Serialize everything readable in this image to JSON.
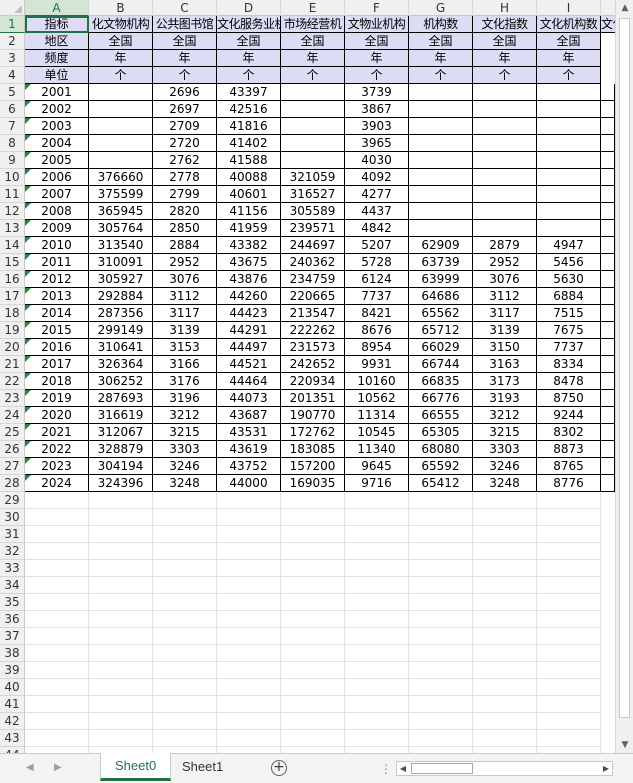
{
  "columns": [
    "A",
    "B",
    "C",
    "D",
    "E",
    "F",
    "G",
    "H",
    "I"
  ],
  "row_numbers": [
    "1",
    "2",
    "3",
    "4",
    "5",
    "6",
    "7",
    "8",
    "9",
    "10",
    "11",
    "12",
    "13",
    "14",
    "15",
    "16",
    "17",
    "18",
    "19",
    "20",
    "21",
    "22",
    "23",
    "24",
    "25",
    "26",
    "27",
    "28",
    "29",
    "30",
    "31",
    "32",
    "33",
    "34",
    "35",
    "36",
    "37",
    "38",
    "39",
    "40",
    "41",
    "42",
    "43",
    "44"
  ],
  "header_rows": [
    [
      "指标",
      "化文物机构",
      "公共图书馆",
      "文化服务业机",
      "市场经营机",
      "文物业机构",
      "机构数",
      "文化指数",
      "文化机构数",
      "文化和"
    ],
    [
      "地区",
      "全国",
      "全国",
      "全国",
      "全国",
      "全国",
      "全国",
      "全国",
      "全国"
    ],
    [
      "频度",
      "年",
      "年",
      "年",
      "年",
      "年",
      "年",
      "年",
      "年"
    ],
    [
      "单位",
      "个",
      "个",
      "个",
      "个",
      "个",
      "个",
      "个",
      "个"
    ]
  ],
  "data_rows": [
    [
      "2001",
      "",
      "2696",
      "43397",
      "",
      "3739",
      "",
      "",
      ""
    ],
    [
      "2002",
      "",
      "2697",
      "42516",
      "",
      "3867",
      "",
      "",
      ""
    ],
    [
      "2003",
      "",
      "2709",
      "41816",
      "",
      "3903",
      "",
      "",
      ""
    ],
    [
      "2004",
      "",
      "2720",
      "41402",
      "",
      "3965",
      "",
      "",
      ""
    ],
    [
      "2005",
      "",
      "2762",
      "41588",
      "",
      "4030",
      "",
      "",
      ""
    ],
    [
      "2006",
      "376660",
      "2778",
      "40088",
      "321059",
      "4092",
      "",
      "",
      ""
    ],
    [
      "2007",
      "375599",
      "2799",
      "40601",
      "316527",
      "4277",
      "",
      "",
      ""
    ],
    [
      "2008",
      "365945",
      "2820",
      "41156",
      "305589",
      "4437",
      "",
      "",
      ""
    ],
    [
      "2009",
      "305764",
      "2850",
      "41959",
      "239571",
      "4842",
      "",
      "",
      ""
    ],
    [
      "2010",
      "313540",
      "2884",
      "43382",
      "244697",
      "5207",
      "62909",
      "2879",
      "4947"
    ],
    [
      "2011",
      "310091",
      "2952",
      "43675",
      "240362",
      "5728",
      "63739",
      "2952",
      "5456"
    ],
    [
      "2012",
      "305927",
      "3076",
      "43876",
      "234759",
      "6124",
      "63999",
      "3076",
      "5630"
    ],
    [
      "2013",
      "292884",
      "3112",
      "44260",
      "220665",
      "7737",
      "64686",
      "3112",
      "6884"
    ],
    [
      "2014",
      "287356",
      "3117",
      "44423",
      "213547",
      "8421",
      "65562",
      "3117",
      "7515"
    ],
    [
      "2015",
      "299149",
      "3139",
      "44291",
      "222262",
      "8676",
      "65712",
      "3139",
      "7675"
    ],
    [
      "2016",
      "310641",
      "3153",
      "44497",
      "231573",
      "8954",
      "66029",
      "3150",
      "7737"
    ],
    [
      "2017",
      "326364",
      "3166",
      "44521",
      "242652",
      "9931",
      "66744",
      "3163",
      "8334"
    ],
    [
      "2018",
      "306252",
      "3176",
      "44464",
      "220934",
      "10160",
      "66835",
      "3173",
      "8478"
    ],
    [
      "2019",
      "287693",
      "3196",
      "44073",
      "201351",
      "10562",
      "66776",
      "3193",
      "8750"
    ],
    [
      "2020",
      "316619",
      "3212",
      "43687",
      "190770",
      "11314",
      "66555",
      "3212",
      "9244"
    ],
    [
      "2021",
      "312067",
      "3215",
      "43531",
      "172762",
      "10545",
      "65305",
      "3215",
      "8302"
    ],
    [
      "2022",
      "328879",
      "3303",
      "43619",
      "183085",
      "11340",
      "68080",
      "3303",
      "8873"
    ],
    [
      "2023",
      "304194",
      "3246",
      "43752",
      "157200",
      "9645",
      "65592",
      "3246",
      "8765"
    ],
    [
      "2024",
      "324396",
      "3248",
      "44000",
      "169035",
      "9716",
      "65412",
      "3248",
      "8776"
    ]
  ],
  "tabs": [
    {
      "label": "Sheet0",
      "active": true
    },
    {
      "label": "Sheet1",
      "active": false
    }
  ],
  "add_sheet_symbol": "+",
  "tab_separator": "⋮",
  "colors": {
    "accent": "#217346",
    "header_fill": "#dcdcf5",
    "error_marker": "#1e8a3c"
  },
  "icons": {
    "add_sheet": "plus-circle-icon",
    "nav_prev": "triangle-left-icon",
    "nav_next": "triangle-right-icon"
  }
}
